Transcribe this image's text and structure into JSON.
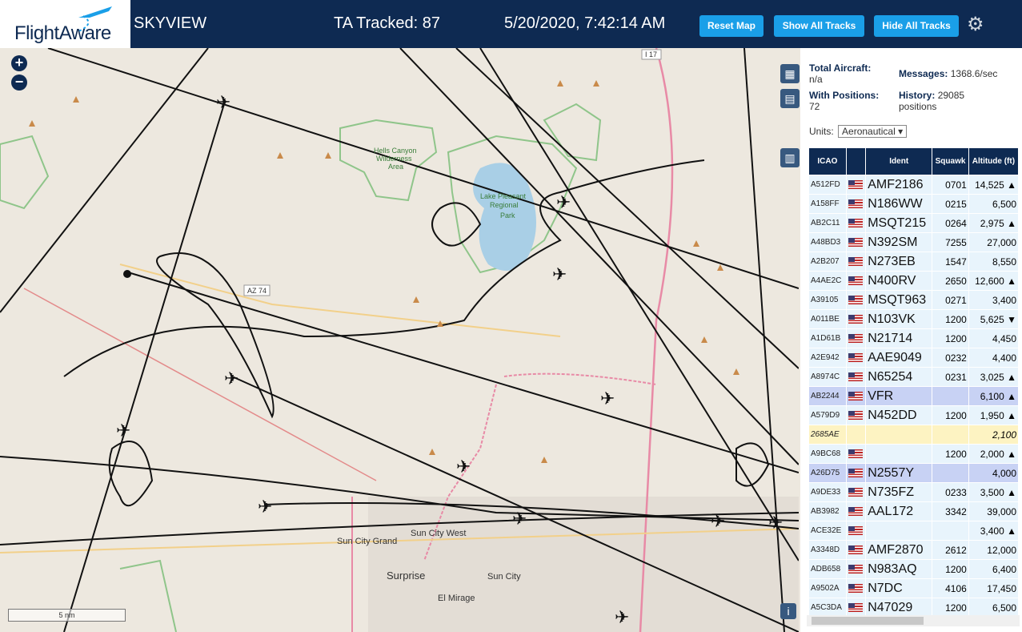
{
  "header": {
    "logo": "FlightAware",
    "site_name": "SKYVIEW",
    "tracked": "TA Tracked: 87",
    "datetime": "5/20/2020, 7:42:14 AM",
    "reset_map": "Reset Map",
    "show_all_tracks": "Show All Tracks",
    "hide_all_tracks": "Hide All Tracks",
    "settings_icon": "gear-icon"
  },
  "map": {
    "zoom_in": "+",
    "zoom_out": "−",
    "scale": "5 nm",
    "labels": {
      "hells_canyon": "Hells Canyon",
      "wilderness": "Wilderness",
      "area": "Area",
      "lake_pleasant": "Lake Pleasant",
      "regional": "Regional",
      "park": "Park",
      "az74": "AZ 74",
      "i17": "I 17",
      "sun_city_grand": "Sun City Grand",
      "sun_city_west": "Sun City West",
      "surprise": "Surprise",
      "sun_city": "Sun City",
      "el_mirage": "El Mirage"
    },
    "info_button": "i"
  },
  "panel": {
    "total_aircraft_label": "Total Aircraft:",
    "total_aircraft_value": "n/a",
    "messages_label": "Messages:",
    "messages_value": "1368.6/sec",
    "with_positions_label": "With Positions:",
    "with_positions_value": "72",
    "history_label": "History:",
    "history_value": "29085",
    "history_unit": "positions",
    "units_label": "Units:",
    "units_value": "Aeronautical ▾",
    "columns": [
      "ICAO",
      "",
      "Ident",
      "Squawk",
      "Altitude (ft)"
    ],
    "rows": [
      {
        "icao": "A512FD",
        "ident": "AMF2186",
        "squawk": "0701",
        "alt": "14,525 ▲",
        "style": ""
      },
      {
        "icao": "A158FF",
        "ident": "N186WW",
        "squawk": "0215",
        "alt": "6,500",
        "style": ""
      },
      {
        "icao": "AB2C11",
        "ident": "MSQT215",
        "squawk": "0264",
        "alt": "2,975 ▲",
        "style": ""
      },
      {
        "icao": "A48BD3",
        "ident": "N392SM",
        "squawk": "7255",
        "alt": "27,000",
        "style": ""
      },
      {
        "icao": "A2B207",
        "ident": "N273EB",
        "squawk": "1547",
        "alt": "8,550",
        "style": ""
      },
      {
        "icao": "A4AE2C",
        "ident": "N400RV",
        "squawk": "2650",
        "alt": "12,600 ▲",
        "style": ""
      },
      {
        "icao": "A39105",
        "ident": "MSQT963",
        "squawk": "0271",
        "alt": "3,400",
        "style": ""
      },
      {
        "icao": "A011BE",
        "ident": "N103VK",
        "squawk": "1200",
        "alt": "5,625 ▼",
        "style": ""
      },
      {
        "icao": "A1D61B",
        "ident": "N21714",
        "squawk": "1200",
        "alt": "4,450",
        "style": ""
      },
      {
        "icao": "A2E942",
        "ident": "AAE9049",
        "squawk": "0232",
        "alt": "4,400",
        "style": ""
      },
      {
        "icao": "A8974C",
        "ident": "N65254",
        "squawk": "0231",
        "alt": "3,025 ▲",
        "style": ""
      },
      {
        "icao": "AB2244",
        "ident": "VFR",
        "squawk": "",
        "alt": "6,100 ▲",
        "style": "hl"
      },
      {
        "icao": "A579D9",
        "ident": "N452DD",
        "squawk": "1200",
        "alt": "1,950 ▲",
        "style": ""
      },
      {
        "icao": "2685AE",
        "ident": "",
        "squawk": "",
        "alt": "2,100",
        "style": "yl",
        "noflag": true
      },
      {
        "icao": "A9BC68",
        "ident": "",
        "squawk": "1200",
        "alt": "2,000 ▲",
        "style": ""
      },
      {
        "icao": "A26D75",
        "ident": "N2557Y",
        "squawk": "",
        "alt": "4,000",
        "style": "hl"
      },
      {
        "icao": "A9DE33",
        "ident": "N735FZ",
        "squawk": "0233",
        "alt": "3,500 ▲",
        "style": ""
      },
      {
        "icao": "AB3982",
        "ident": "AAL172",
        "squawk": "3342",
        "alt": "39,000",
        "style": ""
      },
      {
        "icao": "ACE32E",
        "ident": "",
        "squawk": "",
        "alt": "3,400 ▲",
        "style": ""
      },
      {
        "icao": "A3348D",
        "ident": "AMF2870",
        "squawk": "2612",
        "alt": "12,000",
        "style": ""
      },
      {
        "icao": "ADB658",
        "ident": "N983AQ",
        "squawk": "1200",
        "alt": "6,400",
        "style": ""
      },
      {
        "icao": "A9502A",
        "ident": "N7DC",
        "squawk": "4106",
        "alt": "17,450",
        "style": ""
      },
      {
        "icao": "A5C3DA",
        "ident": "N47029",
        "squawk": "1200",
        "alt": "6,500",
        "style": ""
      }
    ]
  }
}
